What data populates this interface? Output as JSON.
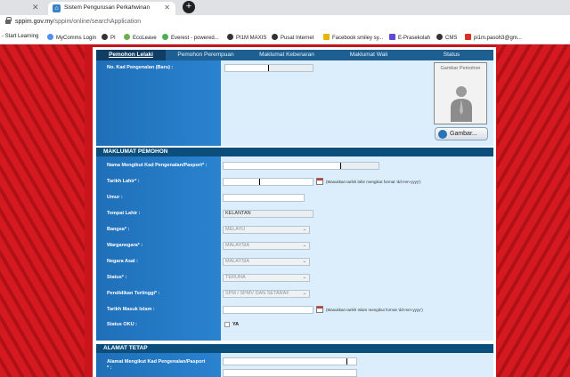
{
  "browser": {
    "tab_title": "Sistem Pengurusan Perkahwinan",
    "url_host": "sppim.gov.my",
    "url_path": "/sppim/online/searchApplication",
    "bookmarks": [
      "- Start Learning",
      "MyComms Login",
      "PI",
      "EcoLeave",
      "Everest - powered...",
      "PI1M MAXIS",
      "Pusat Internet",
      "Facebook smiley sy...",
      "E-Prasekolah",
      "CMS",
      "pi1m.pasoh3@gm..."
    ]
  },
  "form": {
    "tabs": [
      "Pemohon Lelaki",
      "Pemohon Perempuan",
      "Maklumat Kebenaran",
      "Maklumat Wali",
      "Status"
    ],
    "id_label": "No. Kad Pengenalan (Baru) :",
    "photo_label": "Gambar Pemohon",
    "photo_button": "Gambar...",
    "section_pemohon": "MAKLUMAT PEMOHON",
    "fields": {
      "nama_label": "Nama Mengikut Kad Pengenalan/Pasport* :",
      "tarikh_lahir_label": "Tarikh Lahir* :",
      "tarikh_hint": "(Masukkan tarikh lahir mengikut format 'dd-mm-yyyy')",
      "umur_label": "Umur :",
      "tempat_lahir_label": "Tempat Lahir :",
      "tempat_lahir_value": "KELANTAN",
      "bangsa_label": "Bangsa* :",
      "bangsa_value": "MELAYU",
      "warganegara_label": "Warganegara* :",
      "warganegara_value": "MALAYSIA",
      "negara_asal_label": "Negara Asal :",
      "negara_asal_value": "MALAYSIA",
      "status_label": "Status* :",
      "status_value": "TERUNA",
      "pendidikan_label": "Pendidikan Tertinggi* :",
      "pendidikan_value": "SPM / SPMV DAN SETARAF",
      "tarikh_islam_label": "Tarikh Masuk Islam :",
      "tarikh_islam_hint": "(Masukkan tarikh Islam mengikut format 'dd-mm-yyyy')",
      "oku_label": "Status OKU :",
      "oku_option": "YA"
    },
    "section_alamat": "ALAMAT TETAP",
    "alamat_label": "Alamat Mengikut Kad Pengenalan/Pasport",
    "alamat_label_2": "* :"
  },
  "colors": {
    "page_red": "#c8141b",
    "tab_bar": "#1e5f91",
    "section_header": "#0b4e7b",
    "field_panel": "#dceefb"
  }
}
